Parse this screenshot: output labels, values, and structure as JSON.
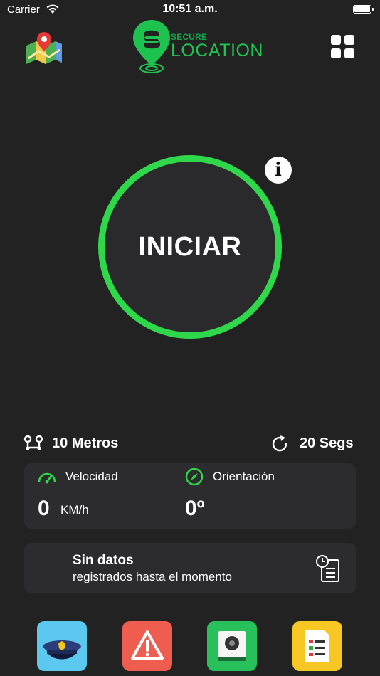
{
  "status_bar": {
    "carrier": "Carrier",
    "time": "10:51 a.m."
  },
  "header": {
    "logo_small": "SECURE",
    "logo_large": "LOCATION",
    "icons": {
      "left": "map-pin-icon",
      "right": "grid-menu-icon"
    }
  },
  "main": {
    "start_label": "INICIAR",
    "info_glyph": "i"
  },
  "settings": {
    "distance": "10 Metros",
    "interval": "20 Segs"
  },
  "stats": {
    "speed_label": "Velocidad",
    "speed_value": "0",
    "speed_unit": "KM/h",
    "heading_label": "Orientación",
    "heading_value": "0º"
  },
  "record": {
    "title": "Sin datos",
    "subtitle": "registrados hasta el momento"
  },
  "bottom_bar": {
    "icons": [
      "police-cap-icon",
      "warning-icon",
      "camera-icon",
      "checklist-icon"
    ]
  },
  "colors": {
    "accent_green": "#2ed84a",
    "background": "#222222",
    "card": "#2c2c2e"
  }
}
